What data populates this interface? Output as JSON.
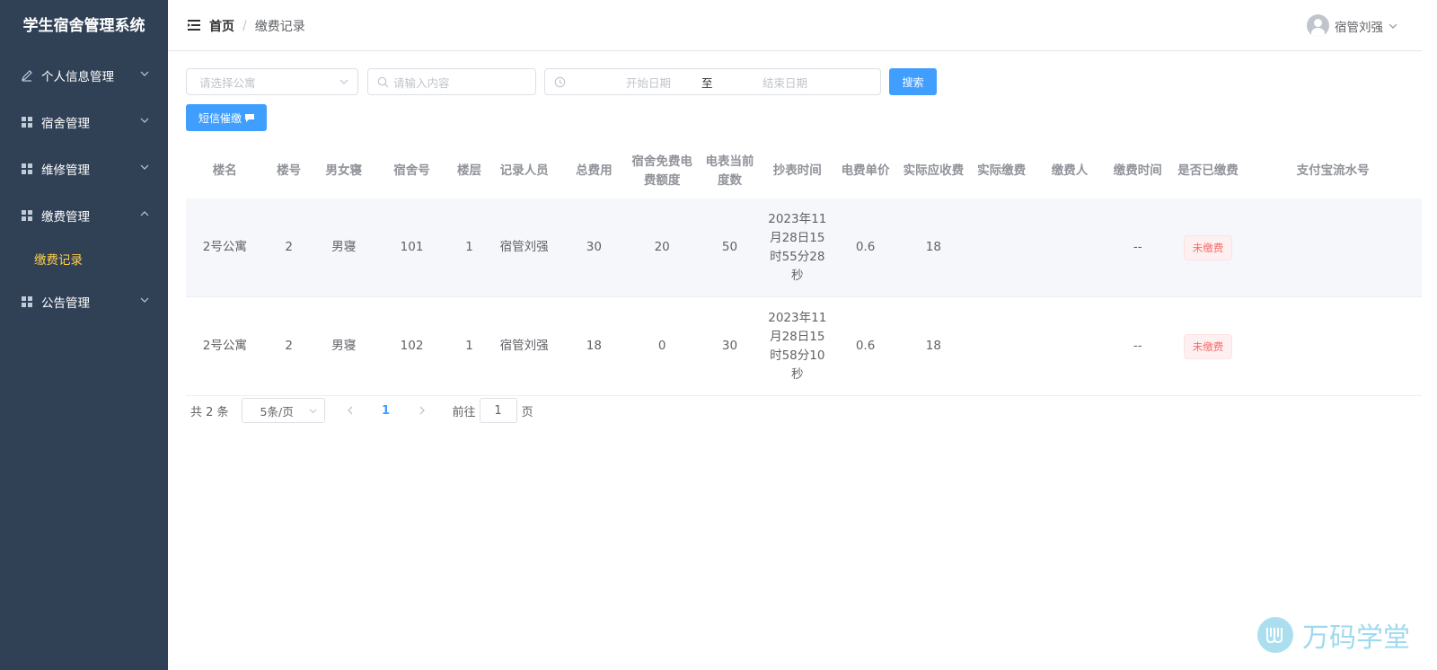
{
  "app": {
    "title": "学生宿舍管理系统"
  },
  "sidebar": {
    "items": [
      {
        "label": "个人信息管理",
        "icon": "edit-icon",
        "expanded": false
      },
      {
        "label": "宿舍管理",
        "icon": "grid-icon",
        "expanded": false
      },
      {
        "label": "维修管理",
        "icon": "grid-icon",
        "expanded": false
      },
      {
        "label": "缴费管理",
        "icon": "grid-icon",
        "expanded": true
      },
      {
        "label": "公告管理",
        "icon": "grid-icon",
        "expanded": false
      }
    ],
    "sub_item": {
      "label": "缴费记录",
      "active": true
    }
  },
  "header": {
    "breadcrumb": {
      "home": "首页",
      "separator": "/",
      "current": "缴费记录"
    },
    "user": {
      "name": "宿管刘强"
    }
  },
  "filters": {
    "apartment_placeholder": "请选择公寓",
    "search_placeholder": "请输入内容",
    "start_date_placeholder": "开始日期",
    "date_separator": "至",
    "end_date_placeholder": "结束日期",
    "search_button": "搜索",
    "sms_button": "短信催缴"
  },
  "table": {
    "columns": [
      "楼名",
      "楼号",
      "男女寝",
      "宿舍号",
      "楼层",
      "记录人员",
      "总费用",
      "宿舍免费电费额度",
      "电表当前度数",
      "抄表时间",
      "电费单价",
      "实际应收费",
      "实际缴费",
      "缴费人",
      "缴费时间",
      "是否已缴费",
      "支付宝流水号"
    ],
    "rows": [
      {
        "building": "2号公寓",
        "building_no": "2",
        "gender": "男寝",
        "room": "101",
        "floor": "1",
        "recorder": "宿管刘强",
        "total": "30",
        "free_quota": "20",
        "meter": "50",
        "read_time": "2023年11月28日15时55分28秒",
        "unit_price": "0.6",
        "receivable": "18",
        "paid": "",
        "payer": "",
        "pay_time": "--",
        "status": "未缴费",
        "alipay_no": ""
      },
      {
        "building": "2号公寓",
        "building_no": "2",
        "gender": "男寝",
        "room": "102",
        "floor": "1",
        "recorder": "宿管刘强",
        "total": "18",
        "free_quota": "0",
        "meter": "30",
        "read_time": "2023年11月28日15时58分10秒",
        "unit_price": "0.6",
        "receivable": "18",
        "paid": "",
        "payer": "",
        "pay_time": "--",
        "status": "未缴费",
        "alipay_no": ""
      }
    ]
  },
  "pagination": {
    "total": "共 2 条",
    "page_size": "5条/页",
    "current_page": "1",
    "goto_label": "前往",
    "goto_value": "1",
    "page_label": "页"
  },
  "watermark": {
    "text": "万码学堂"
  },
  "colors": {
    "sidebar_bg": "#304156",
    "accent": "#409eff",
    "active_sub": "#ffd04b",
    "danger": "#f56c6c"
  }
}
